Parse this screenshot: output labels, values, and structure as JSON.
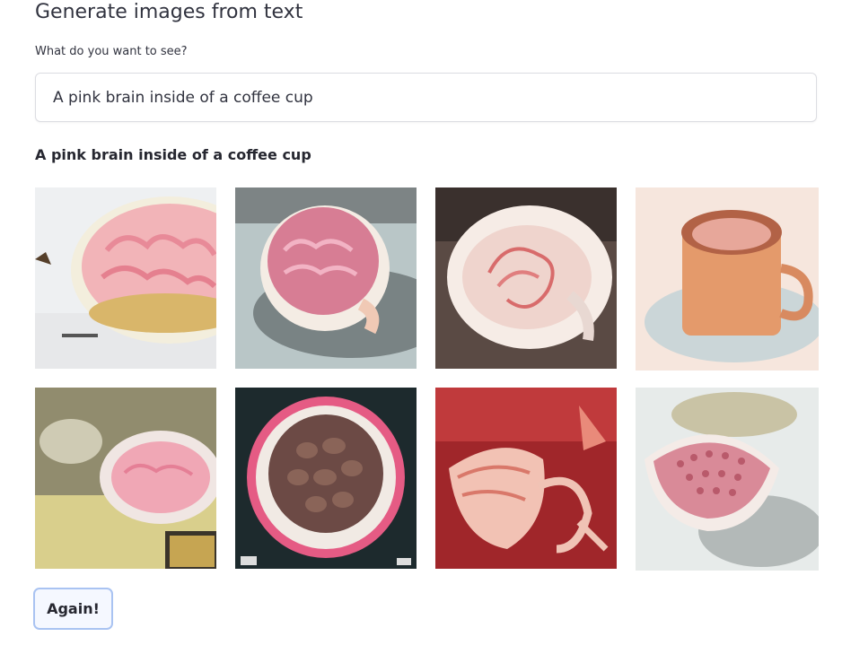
{
  "header": {
    "title": "Generate images from text"
  },
  "prompt": {
    "label": "What do you want to see?",
    "value": "A pink brain inside of a coffee cup"
  },
  "results": {
    "heading": "A pink brain inside of a coffee cup",
    "images": [
      {
        "subject": "pink brain in bowl on white table"
      },
      {
        "subject": "pink brain in white cup on grey background"
      },
      {
        "subject": "white cup with pink swirls on dark background"
      },
      {
        "subject": "orange coffee cup on saucer"
      },
      {
        "subject": "pink brain in bowl on yellow couch"
      },
      {
        "subject": "top-down cup with brown brain on black"
      },
      {
        "subject": "pink cup with handle on red background"
      },
      {
        "subject": "pink patterned cup on white surface"
      }
    ]
  },
  "actions": {
    "again_label": "Again!"
  }
}
